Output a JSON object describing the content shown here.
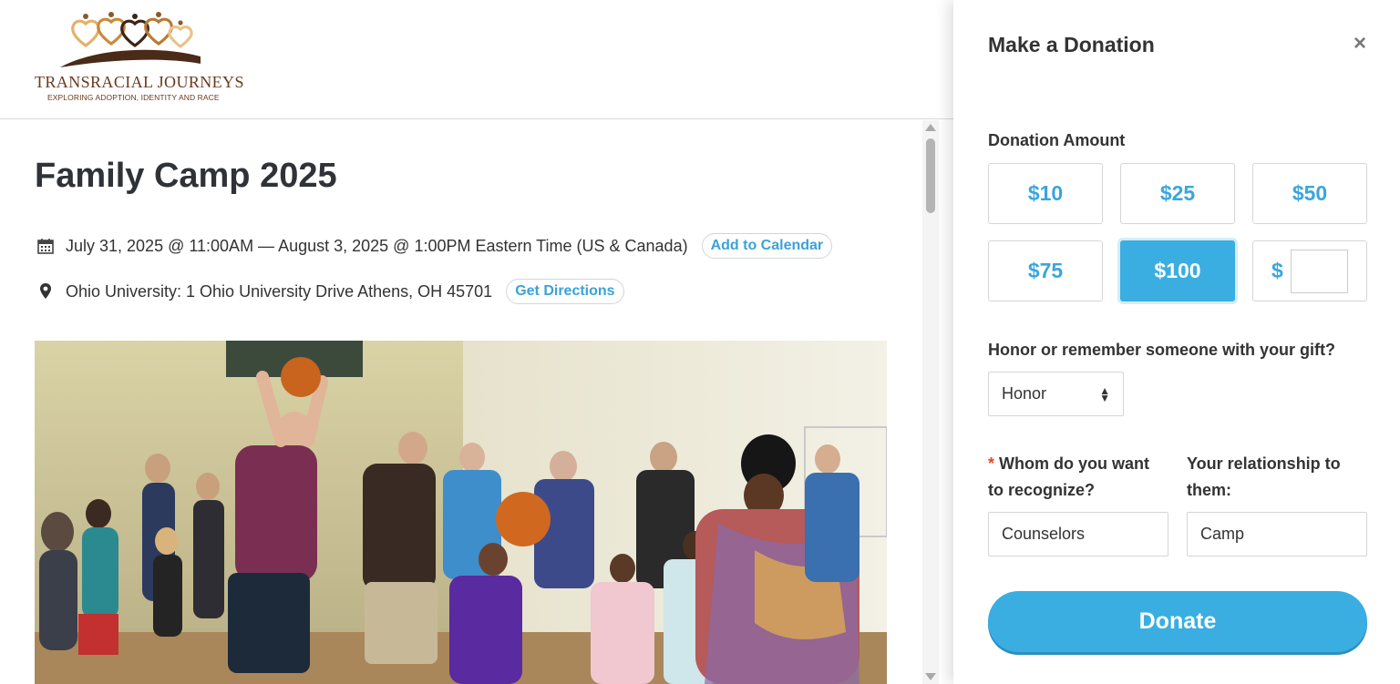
{
  "logo": {
    "name": "TRANSRACIAL JOURNEYS",
    "tagline": "EXPLORING ADOPTION, IDENTITY AND RACE"
  },
  "event": {
    "title": "Family Camp 2025",
    "datetime": "July 31, 2025 @ 11:00AM — August 3, 2025 @ 1:00PM Eastern Time (US & Canada)",
    "add_to_calendar_label": "Add to Calendar",
    "location": "Ohio University: 1 Ohio University Drive Athens, OH 45701",
    "get_directions_label": "Get Directions",
    "date_icon": "calendar-icon",
    "location_icon": "map-pin-icon"
  },
  "donation": {
    "title": "Make a Donation",
    "close_label": "×",
    "amount_label": "Donation Amount",
    "amounts": [
      "$10",
      "$25",
      "$50",
      "$75",
      "$100"
    ],
    "selected_amount": "$100",
    "custom_prefix": "$",
    "custom_value": "",
    "honor_question": "Honor or remember someone with your gift?",
    "honor_select_value": "Honor",
    "recognize_required_mark": "*",
    "recognize_label": "Whom do you want to recognize?",
    "recognize_value": "Counselors",
    "relationship_label": "Your relationship to them:",
    "relationship_value": "Camp",
    "donate_label": "Donate"
  },
  "colors": {
    "accent": "#3aaee0",
    "accent_text": "#3aa6dc",
    "required": "#e04a2f",
    "logo_brown": "#6b3a1e",
    "logo_gold": "#d9a75b"
  }
}
